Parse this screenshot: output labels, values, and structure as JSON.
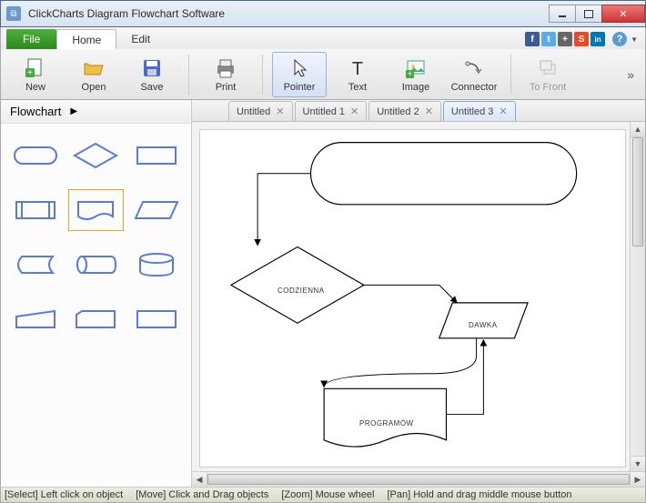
{
  "window": {
    "title": "ClickCharts Diagram Flowchart Software"
  },
  "menu": {
    "file": "File",
    "tabs": [
      "Home",
      "Edit"
    ],
    "active_tab": 0
  },
  "social": [
    {
      "name": "facebook",
      "bg": "#3b5998",
      "glyph": "f"
    },
    {
      "name": "twitter",
      "bg": "#55acee",
      "glyph": "t"
    },
    {
      "name": "google-plus",
      "bg": "#dd4b39",
      "glyph": "+"
    },
    {
      "name": "stumble",
      "bg": "#eb4924",
      "glyph": "S"
    },
    {
      "name": "linkedin",
      "bg": "#0077b5",
      "glyph": "in"
    }
  ],
  "ribbon": {
    "new": "New",
    "open": "Open",
    "save": "Save",
    "print": "Print",
    "pointer": "Pointer",
    "text": "Text",
    "image": "Image",
    "connector": "Connector",
    "tofront": "To Front",
    "selected": "pointer"
  },
  "sidebar": {
    "category": "Flowchart",
    "selected_index": 4
  },
  "doc_tabs": [
    {
      "label": "Untitled",
      "active": false
    },
    {
      "label": "Untitled 1",
      "active": false
    },
    {
      "label": "Untitled 2",
      "active": false
    },
    {
      "label": "Untitled 3",
      "active": true
    }
  ],
  "canvas_nodes": {
    "decision": "CODZIENNA",
    "data": "DAWKA",
    "document": "PROGRAMÓW"
  },
  "status": {
    "select": "[Select] Left click on object",
    "move": "[Move] Click and Drag objects",
    "zoom": "[Zoom] Mouse wheel",
    "pan": "[Pan] Hold and drag middle mouse button"
  }
}
